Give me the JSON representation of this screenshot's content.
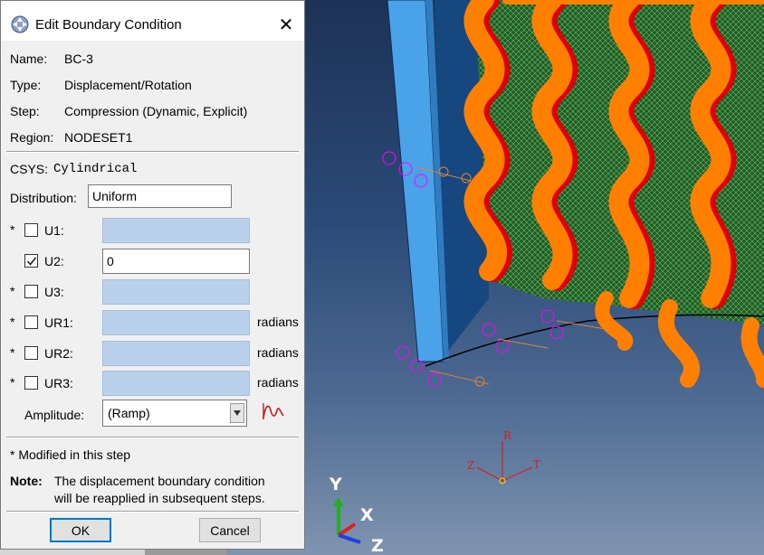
{
  "dialog": {
    "title": "Edit Boundary Condition",
    "close_glyph": "✕",
    "name_label": "Name:",
    "name_value": "BC-3",
    "type_label": "Type:",
    "type_value": "Displacement/Rotation",
    "step_label": "Step:",
    "step_value": "Compression (Dynamic, Explicit)",
    "region_label": "Region:",
    "region_value": "NODESET1",
    "csys_label": "CSYS:",
    "csys_value": "Cylindrical",
    "distribution_label": "Distribution:",
    "distribution_value": "Uniform",
    "dofs": [
      {
        "label": "U1:",
        "star": "*",
        "checked": false,
        "value": "",
        "unit": ""
      },
      {
        "label": "U2:",
        "star": "",
        "checked": true,
        "value": "0",
        "unit": ""
      },
      {
        "label": "U3:",
        "star": "*",
        "checked": false,
        "value": "",
        "unit": ""
      },
      {
        "label": "UR1:",
        "star": "*",
        "checked": false,
        "value": "",
        "unit": "radians"
      },
      {
        "label": "UR2:",
        "star": "*",
        "checked": false,
        "value": "",
        "unit": "radians"
      },
      {
        "label": "UR3:",
        "star": "*",
        "checked": false,
        "value": "",
        "unit": "radians"
      }
    ],
    "amplitude_label": "Amplitude:",
    "amplitude_value": "(Ramp)",
    "modified_note": "* Modified in this step",
    "note_label": "Note:",
    "note_line1": "The displacement boundary condition",
    "note_line2": "will be reapplied in subsequent steps.",
    "ok_label": "OK",
    "cancel_label": "Cancel"
  },
  "viewport": {
    "csys_triad_labels": {
      "r": "R",
      "z": "Z",
      "t": "T"
    },
    "global_triad_labels": {
      "y": "Y",
      "x": "X",
      "z": "Z"
    }
  },
  "colors": {
    "ring_orange": "#ff8000",
    "ring_red": "#e00000",
    "mesh_green": "#1f5a2a",
    "plate_blue": "#4aa3e8",
    "bc_magenta": "#ff00ff",
    "disabled_field": "#b9d1ea"
  }
}
